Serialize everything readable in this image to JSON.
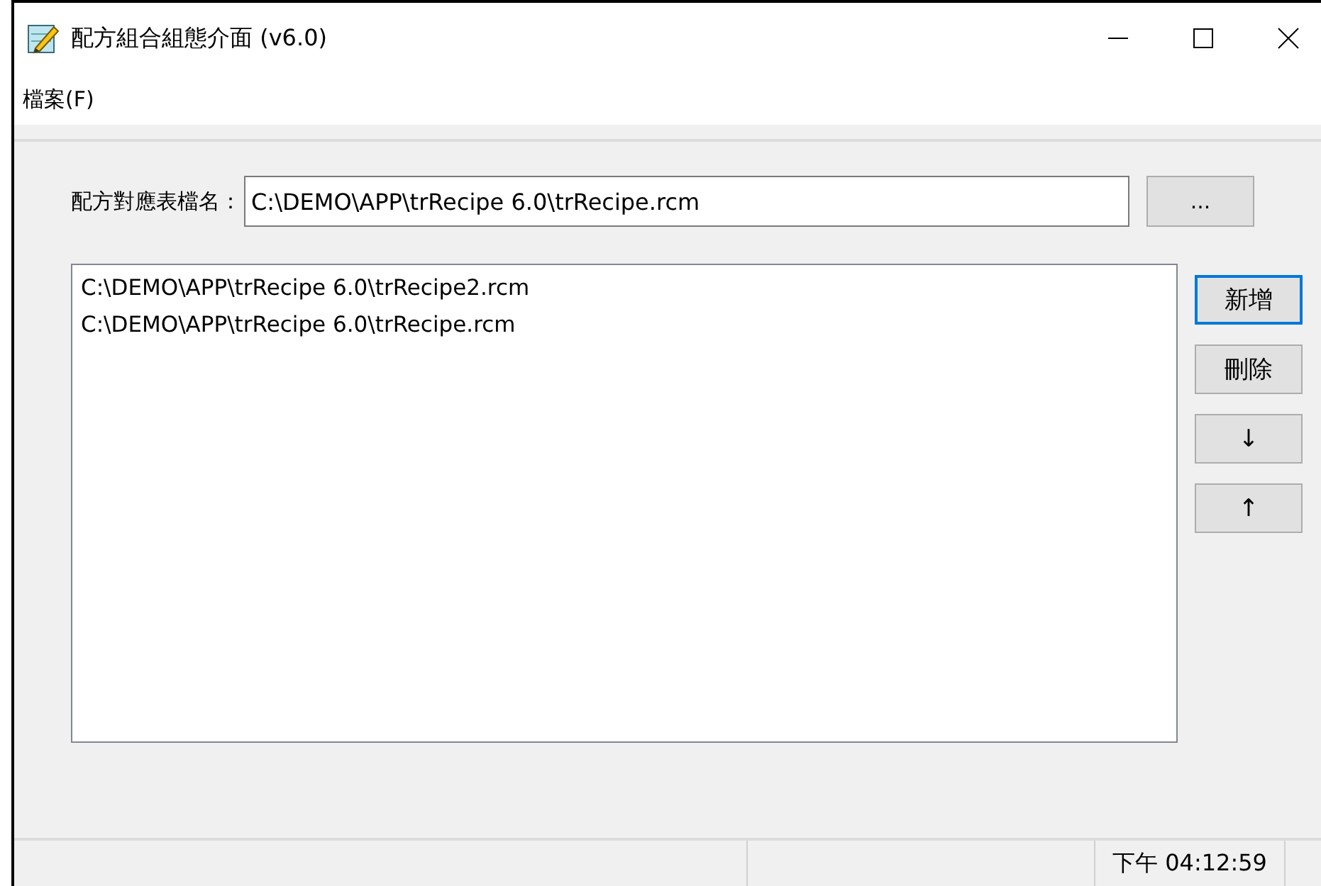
{
  "window": {
    "title": "配方組合組態介面 (v6.0)"
  },
  "menu": [
    {
      "label": "檔案(F)"
    }
  ],
  "file_field": {
    "label": "配方對應表檔名：",
    "value": "C:\\DEMO\\APP\\trRecipe 6.0\\trRecipe.rcm",
    "browse": "..."
  },
  "file_list": {
    "items": [
      {
        "text": "C:\\DEMO\\APP\\trRecipe 6.0\\trRecipe2.rcm",
        "selected": false
      },
      {
        "text": "C:\\DEMO\\APP\\trRecipe 6.0\\trRecipe.rcm",
        "selected": false
      }
    ]
  },
  "buttons": [
    {
      "label": "新增",
      "focused": true
    },
    {
      "label": "刪除",
      "focused": false
    },
    {
      "label": "↓",
      "focused": false
    },
    {
      "label": "↑",
      "focused": false
    }
  ],
  "status_bar": {
    "time": "下午 04:12:59"
  }
}
